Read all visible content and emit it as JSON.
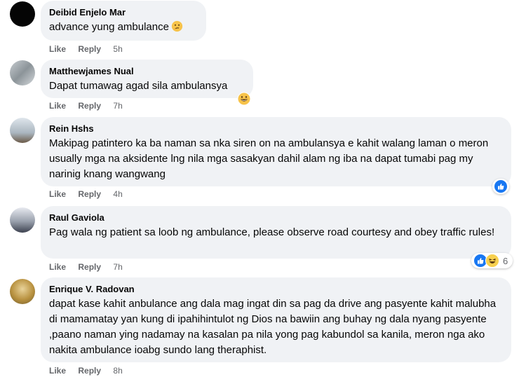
{
  "comments": [
    {
      "author": "Deibid Enjelo Mar",
      "text": "advance yung ambulance",
      "like": "Like",
      "reply": "Reply",
      "time": "5h",
      "avatar_color": "#050505"
    },
    {
      "author": "Matthewjames Nual",
      "text": "Dapat tumawag agad sila ambulansya",
      "like": "Like",
      "reply": "Reply",
      "time": "7h",
      "avatar_color": "#9aa0a6"
    },
    {
      "author": "Rein Hshs",
      "text": "Makipag patintero ka ba naman sa nka siren on na ambulansya e kahit walang laman o meron usually mga na aksidente lng nila mga sasakyan dahil alam ng iba na dapat tumabi pag my narinig knang wangwang",
      "like": "Like",
      "reply": "Reply",
      "time": "4h",
      "avatar_color": "#b8c4cf"
    },
    {
      "author": "Raul Gaviola",
      "text": "Pag wala ng patient sa loob ng ambulance, please observe road courtesy and obey traffic rules!",
      "like": "Like",
      "reply": "Reply",
      "time": "7h",
      "reaction_count": "6",
      "avatar_color": "#c9ccd6"
    },
    {
      "author": "Enrique V. Radovan",
      "text": "dapat kase kahit anbulance ang dala mag ingat din sa pag da drive ang pasyente kahit malubha di mamamatay yan kung di ipahihintulot ng Dios na bawiin ang buhay ng dala nyang pasyente ,paano naman ying nadamay na kasalan pa nila yong pag kabundol sa kanila, meron nga ako nakita ambulance ioabg sundo lang theraphist.",
      "like": "Like",
      "reply": "Reply",
      "time": "8h",
      "avatar_color": "#b89a5a"
    }
  ],
  "colors": {
    "bubble_bg": "#f0f2f5",
    "meta_text": "#65676b",
    "like_blue": "#1877f2",
    "haha_yellow": "#f7d04e"
  },
  "icons": {
    "inline_emoji_1": "thinking-face-icon",
    "inline_emoji_2": "grinning-face-icon",
    "reaction_like": "like-reaction-icon",
    "reaction_haha": "haha-reaction-icon"
  }
}
